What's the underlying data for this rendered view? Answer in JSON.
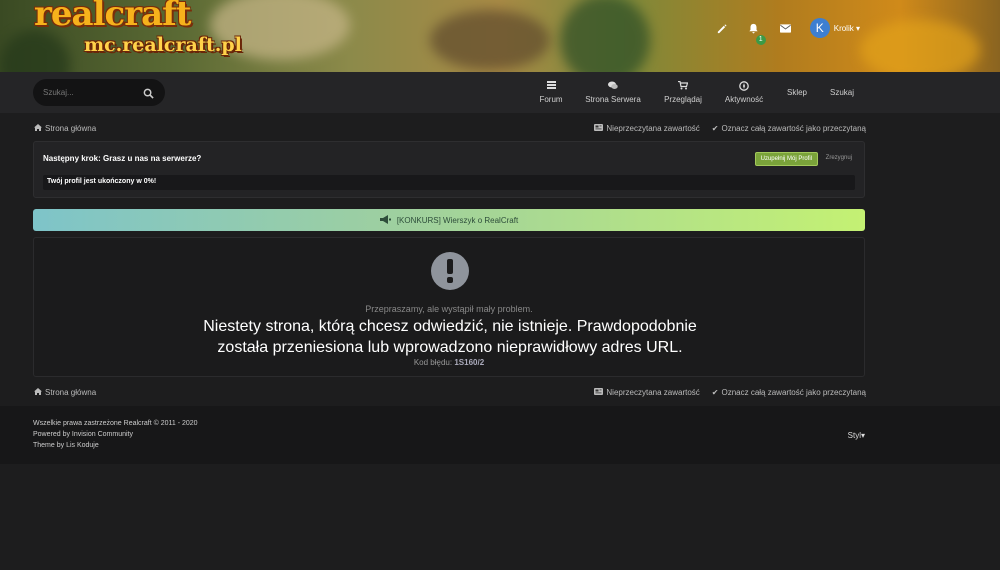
{
  "brand": {
    "line1": "realcraft",
    "line2": "mc.realcraft.pl"
  },
  "userbar": {
    "notifications_count": "1",
    "avatar_letter": "K",
    "username": "Krolik"
  },
  "search": {
    "placeholder": "Szukaj..."
  },
  "nav": [
    {
      "label": "Forum",
      "icon": "list-icon"
    },
    {
      "label": "Strona Serwera",
      "icon": "comments-icon"
    },
    {
      "label": "Przeglądaj",
      "icon": "cart-icon"
    },
    {
      "label": "Aktywność",
      "icon": "compass-icon"
    },
    {
      "label": "Sklep"
    },
    {
      "label": "Szukaj"
    }
  ],
  "breadcrumb": {
    "home": "Strona główna",
    "unread": "Nieprzeczytana zawartość",
    "mark_read": "Oznacz całą zawartość jako przeczytaną"
  },
  "next_step": {
    "title": "Następny krok: Grasz u nas na serwerze?",
    "complete_button": "Uzupełnij Mój Profil",
    "dismiss_button": "Zrezygnuj",
    "progress_text": "Twój profil jest ukończony w 0%!",
    "progress_percent": 0
  },
  "announcement": {
    "text": "[KONKURS] Wierszyk o RealCraft"
  },
  "error": {
    "subtitle": "Przepraszamy, ale wystąpił mały problem.",
    "message": "Niestety strona, którą chcesz odwiedzić, nie istnieje. Prawdopodobnie została przeniesiona lub wprowadzono nieprawidłowy adres URL.",
    "code_label": "Kod błędu:",
    "code": "1S160/2"
  },
  "footer": {
    "copyright": "Wszelkie prawa zastrzeżone Realcraft © 2011 - 2020",
    "powered": "Powered by Invision Community",
    "theme": "Theme by Lis Koduje",
    "style_label": "Styl"
  },
  "colors": {
    "accent_green": "#7aa33a",
    "nav_bg": "#252527",
    "page_bg": "#1d1d1e"
  }
}
